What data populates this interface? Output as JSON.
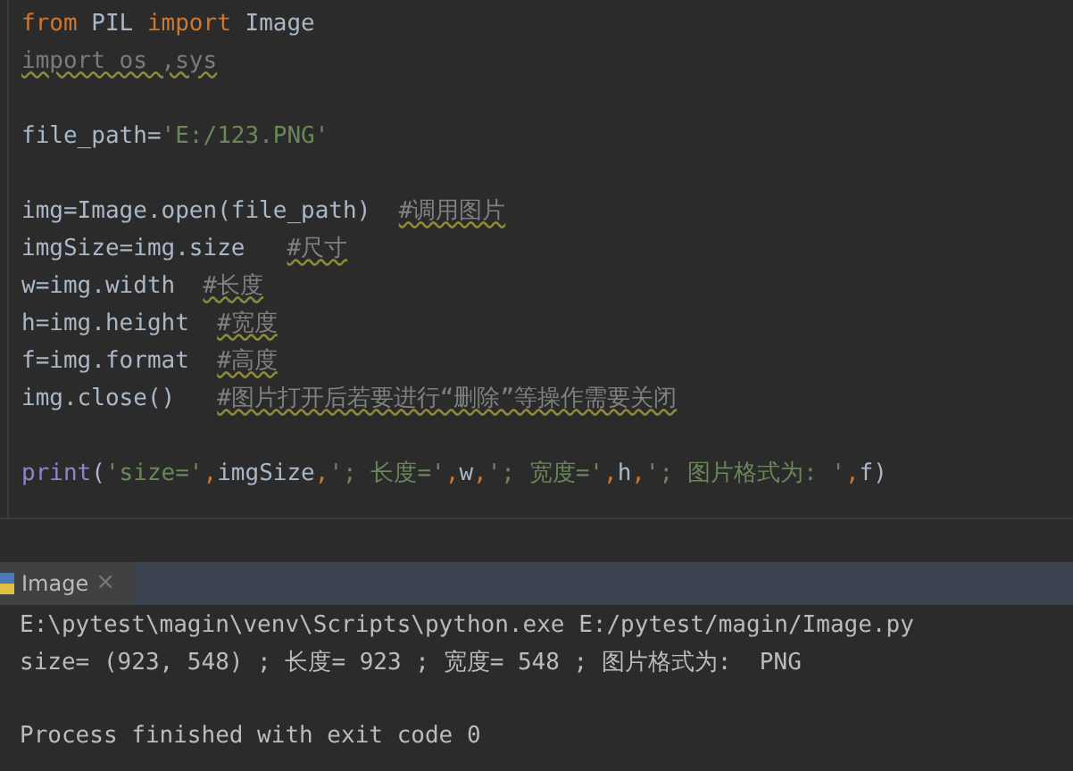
{
  "editor": {
    "blocks": [
      {
        "lines": [
          [
            {
              "kind": "keyword",
              "text": "from"
            },
            {
              "kind": "plain",
              "text": " PIL "
            },
            {
              "kind": "keyword",
              "text": "import"
            },
            {
              "kind": "plain",
              "text": " Image"
            }
          ],
          [
            {
              "kind": "unused",
              "text": "import os ,sys"
            }
          ]
        ]
      },
      {
        "lines": [
          [
            {
              "kind": "plain",
              "text": "file_path="
            },
            {
              "kind": "string",
              "text": "'E:/123.PNG'"
            }
          ]
        ]
      },
      {
        "lines": [
          [
            {
              "kind": "plain",
              "text": "img=Image.open(file_path)  "
            },
            {
              "kind": "comment",
              "text": "#调用图片"
            }
          ],
          [
            {
              "kind": "plain",
              "text": "imgSize=img.size   "
            },
            {
              "kind": "comment",
              "text": "#尺寸"
            }
          ],
          [
            {
              "kind": "plain",
              "text": "w=img.width  "
            },
            {
              "kind": "comment",
              "text": "#长度"
            }
          ],
          [
            {
              "kind": "plain",
              "text": "h=img.height  "
            },
            {
              "kind": "comment",
              "text": "#宽度"
            }
          ],
          [
            {
              "kind": "plain",
              "text": "f=img.format  "
            },
            {
              "kind": "comment",
              "text": "#高度"
            }
          ],
          [
            {
              "kind": "plain",
              "text": "img.close()   "
            },
            {
              "kind": "comment",
              "text": "#图片打开后若要进行“删除”等操作需要关闭"
            }
          ]
        ]
      },
      {
        "lines": [
          [
            {
              "kind": "builtin",
              "text": "print"
            },
            {
              "kind": "plain",
              "text": "("
            },
            {
              "kind": "string",
              "text": "'size='"
            },
            {
              "kind": "comma",
              "text": ","
            },
            {
              "kind": "plain",
              "text": "imgSize"
            },
            {
              "kind": "comma",
              "text": ","
            },
            {
              "kind": "string",
              "text": "'; 长度='"
            },
            {
              "kind": "comma",
              "text": ","
            },
            {
              "kind": "plain",
              "text": "w"
            },
            {
              "kind": "comma",
              "text": ","
            },
            {
              "kind": "string",
              "text": "'; 宽度='"
            },
            {
              "kind": "comma",
              "text": ","
            },
            {
              "kind": "plain",
              "text": "h"
            },
            {
              "kind": "comma",
              "text": ","
            },
            {
              "kind": "string",
              "text": "'; 图片格式为: '"
            },
            {
              "kind": "comma",
              "text": ","
            },
            {
              "kind": "plain",
              "text": "f)"
            }
          ]
        ]
      }
    ]
  },
  "run_panel": {
    "tab": {
      "label": "Image",
      "close": "×"
    },
    "output_blocks": [
      [
        "E:\\pytest\\magin\\venv\\Scripts\\python.exe E:/pytest/magin/Image.py",
        "size= (923, 548) ; 长度= 923 ; 宽度= 548 ; 图片格式为:  PNG"
      ],
      [
        "Process finished with exit code 0"
      ]
    ]
  }
}
